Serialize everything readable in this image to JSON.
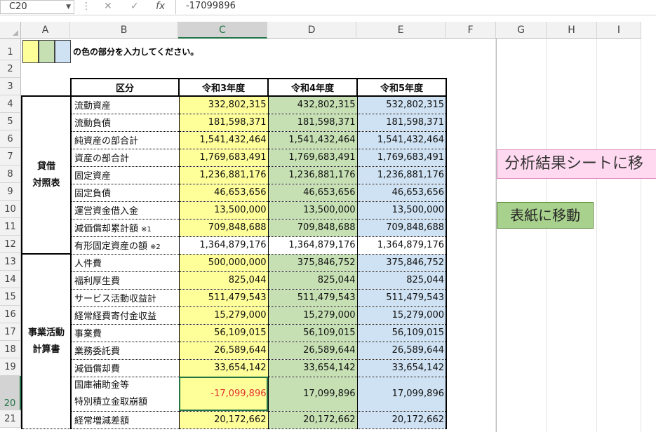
{
  "formula_bar": {
    "name_box": "C20",
    "cancel_glyph": "✕",
    "enter_glyph": "✓",
    "fx_glyph": "fx",
    "value": "-17099896"
  },
  "columns": [
    "A",
    "B",
    "C",
    "D",
    "E",
    "F",
    "G",
    "H",
    "I"
  ],
  "rows": [
    "1",
    "2",
    "3",
    "4",
    "5",
    "6",
    "7",
    "8",
    "9",
    "10",
    "11",
    "12",
    "13",
    "14",
    "15",
    "16",
    "17",
    "18",
    "19",
    "20",
    "21"
  ],
  "instruction": "の色の部分を入力してください。",
  "header": {
    "category": "区分",
    "y3": "令和3年度",
    "y4": "令和4年度",
    "y5": "令和5年度"
  },
  "groups": {
    "bs_line1": "貸借",
    "bs_line2": "対照表",
    "pl_line1": "事業活動",
    "pl_line2": "計算書"
  },
  "items": [
    {
      "label": "流動資産",
      "note": "",
      "y3": "332,802,315",
      "y4": "432,802,315",
      "y5": "532,802,315"
    },
    {
      "label": "流動負債",
      "note": "",
      "y3": "181,598,371",
      "y4": "181,598,371",
      "y5": "181,598,371"
    },
    {
      "label": "純資産の部合計",
      "note": "",
      "y3": "1,541,432,464",
      "y4": "1,541,432,464",
      "y5": "1,541,432,464"
    },
    {
      "label": "資産の部合計",
      "note": "",
      "y3": "1,769,683,491",
      "y4": "1,769,683,491",
      "y5": "1,769,683,491"
    },
    {
      "label": "固定資産",
      "note": "",
      "y3": "1,236,881,176",
      "y4": "1,236,881,176",
      "y5": "1,236,881,176"
    },
    {
      "label": "固定負債",
      "note": "",
      "y3": "46,653,656",
      "y4": "46,653,656",
      "y5": "46,653,656"
    },
    {
      "label": "運営資金借入金",
      "note": "",
      "y3": "13,500,000",
      "y4": "13,500,000",
      "y5": "13,500,000"
    },
    {
      "label": "減価償却累計額",
      "note": "※1",
      "y3": "709,848,688",
      "y4": "709,848,688",
      "y5": "709,848,688"
    },
    {
      "label": "有形固定資産の額",
      "note": "※2",
      "y3": "1,364,879,176",
      "y4": "1,364,879,176",
      "y5": "1,364,879,176"
    },
    {
      "label": "人件費",
      "note": "",
      "y3": "500,000,000",
      "y4": "375,846,752",
      "y5": "375,846,752"
    },
    {
      "label": "福利厚生費",
      "note": "",
      "y3": "825,044",
      "y4": "825,044",
      "y5": "825,044"
    },
    {
      "label": "サービス活動収益計",
      "note": "",
      "y3": "511,479,543",
      "y4": "511,479,543",
      "y5": "511,479,543"
    },
    {
      "label": "経常経費寄付金収益",
      "note": "",
      "y3": "15,279,000",
      "y4": "15,279,000",
      "y5": "15,279,000"
    },
    {
      "label": "事業費",
      "note": "",
      "y3": "56,109,015",
      "y4": "56,109,015",
      "y5": "56,109,015"
    },
    {
      "label": "業務委託費",
      "note": "",
      "y3": "26,589,644",
      "y4": "26,589,644",
      "y5": "26,589,644"
    },
    {
      "label": "減価償却費",
      "note": "",
      "y3": "33,654,142",
      "y4": "33,654,142",
      "y5": "33,654,142"
    },
    {
      "label": "国庫補助金等",
      "label2": "特別積立金取崩額",
      "note": "",
      "y3": "-17,099,896",
      "y4": "17,099,896",
      "y5": "17,099,896"
    },
    {
      "label": "経常増減差額",
      "note": "",
      "y3": "20,172,662",
      "y4": "20,172,662",
      "y5": "20,172,662"
    }
  ],
  "buttons": {
    "analysis": "分析結果シートに移",
    "cover": "表紙に移動"
  },
  "colors": {
    "yellow": "#ffff99",
    "green": "#c6e0b4",
    "blue": "#cfe2f3",
    "negative": "#e03030",
    "pink_button": "#ffd9f0",
    "green_button": "#a9d18e",
    "excel_green": "#217346"
  }
}
